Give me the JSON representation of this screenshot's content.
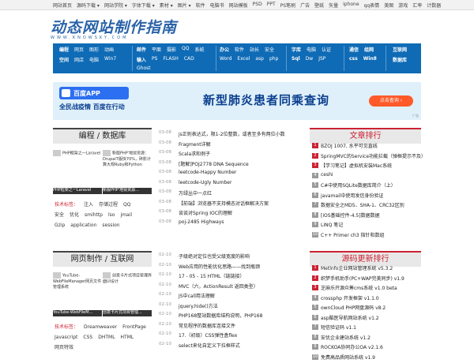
{
  "topbar": {
    "links": [
      "网站首页",
      "源码下载 ▾",
      "网站学院 ▾",
      "字体下载 ▾",
      "素材 ▾",
      "图片 ▾",
      "软件",
      "电脑书",
      "网站模板",
      "PSD",
      "PPT",
      "PS笔刷",
      "广告",
      "壁纸",
      "矢量",
      "iphone",
      "qq表情",
      "美图",
      "游戏",
      "汇率",
      "计数器"
    ]
  },
  "logo": {
    "title": "动态网站制作指南",
    "sub": "WWW.KNOWSKY.COM"
  },
  "nav": {
    "g1": {
      "r1": [
        "编程",
        "网页",
        "图形",
        "动画"
      ],
      "r2": [
        "空间",
        "网店",
        "电脑",
        "Win7"
      ]
    },
    "g2": {
      "r1": [
        "邮件",
        "平面",
        "摄影",
        "QQ",
        "系统"
      ],
      "r2": [
        "输入",
        "PS",
        "FLASH",
        "CAD"
      ],
      "r3": [
        "Ghost"
      ]
    },
    "g3": {
      "r1": [
        "办公",
        "软件",
        "站长",
        "安全"
      ],
      "r2": [
        "Word",
        "Excel",
        "asp",
        "php"
      ]
    },
    "g4": {
      "r1": [
        "字库",
        "电脑",
        "认证"
      ],
      "r2": [
        "Sql",
        "Dw",
        "JSP"
      ]
    },
    "g5": {
      "r1": [
        "通信",
        "组网"
      ],
      "r2": [
        "css",
        "Win8"
      ]
    },
    "g6": {
      "r1": [
        "互联网"
      ],
      "r2": [
        "数据库"
      ]
    }
  },
  "banner": {
    "app": "百度APP",
    "sub": "全民战疫情 百度在行动",
    "headline": "新型肺炎患者同乘查询",
    "button": "点击查询 ›",
    "ad": "广告"
  },
  "sec1": {
    "title": "编程 / 数据库",
    "thumbs": [
      {
        "alt": "PHP框架之一Laravel",
        "cap": "PHP框架之一Laravel"
      },
      {
        "alt": "新版PHP'地狱资源：Drupal7版快70%，碎影计算大规Ruby和Python",
        "cap": "新版PHP'地狱资源..."
      }
    ],
    "tag_label": "技术标签：",
    "tags": [
      "注入",
      "存储过程",
      "QQ",
      "安全",
      "优化",
      "smihttp",
      "lso",
      "jmail",
      "Gzip",
      "application",
      "session"
    ],
    "items": [
      {
        "d": "03-08",
        "t": "js正则表达式，限1-2位整数，或者至多有两位小数"
      },
      {
        "d": "03-08",
        "t": "Fragment详解"
      },
      {
        "d": "03-08",
        "t": "Scala求和例子"
      },
      {
        "d": "03-08",
        "t": "[题解]POJ2778 DNA Sequence"
      },
      {
        "d": "03-08",
        "t": "leetcode-Happy Number"
      },
      {
        "d": "03-08",
        "t": "leetcode-Ugly Number"
      },
      {
        "d": "03-08",
        "t": "万绿丛中一点红"
      },
      {
        "d": "03-08",
        "t": "【前端】浏览器不支持模态对话框解决方案"
      },
      {
        "d": "03-08",
        "t": "谈谈对Spring IOC的理解"
      },
      {
        "d": "03-08",
        "t": "poj-2485 Highways"
      }
    ]
  },
  "sec2": {
    "title": "网页制作 / 互联网",
    "thumbs": [
      {
        "alt": "YouTube-WebFileManager网页文件管理系统",
        "cap": "YouTube-WebFileM..."
      },
      {
        "alt": "创意卡片式项目管理界面UI设计",
        "cap": "创意卡片式项目管理..."
      }
    ],
    "tag_label": "技术标签：",
    "tags": [
      "Dreamweaver",
      "FrontPage",
      "Javascript",
      "CSS",
      "DHTML",
      "HTML",
      "网页特效"
    ],
    "items": [
      {
        "d": "02-10",
        "t": "子级绝对定位也受父级宽度的影响"
      },
      {
        "d": "02-10",
        "t": "Web应用的性能优化思路——找到瓶颈"
      },
      {
        "d": "02-10",
        "t": "17 - 05 - 15 HTML（链链接）"
      },
      {
        "d": "02-10",
        "t": "MVC（六，ActionResult 返回类型）"
      },
      {
        "d": "02-10",
        "t": "JS中call用法理解"
      },
      {
        "d": "02-10",
        "t": "jquery.hide()方法"
      },
      {
        "d": "02-10",
        "t": "PHP168整站数据库结构说明，PHP168"
      },
      {
        "d": "02-10",
        "t": "常见程序的数据库连接文件"
      },
      {
        "d": "02-10",
        "t": "17.（初级）CSS弹性盒flex"
      },
      {
        "d": "02-10",
        "t": "select来化自定义下拉框样式"
      }
    ]
  },
  "rank": {
    "title": "文章排行",
    "items": [
      "BZOJ 1007, 水平可见直线",
      "SpringMVC的Service功能拦截（弹框提示不及）",
      "【学习笔记】虚拟机安装Mac系统",
      "ceshi",
      "C#中使用SQLite数据库简介（上）",
      "javamail中使用发信身份验证",
      "数据安全之MD5、SHA-1、CRC32区别",
      "[iOS基础控件-4.5]数据数据",
      "LINQ 笔记",
      "C++ Primer ch3 指针和数组"
    ]
  },
  "src": {
    "title": "源码更新排行",
    "items": [
      "Metlnfo企业网站管理系统 v5.3.2",
      "织梦手机助手(PC+WAP完美同步) v1.9",
      "芝麻乐开源众筹cms系统 v1.0 beta",
      "crossphp 开发框架 v1.1.0",
      "ownCloud PHP网盘源码 v8.2",
      "asp酷医导航网站系统 v1.2",
      "短信验证码 v1.1",
      "安优企业建站系统 v1.2",
      "ROCKOA协同办公OA v2.1.6",
      "免费高品质网站系统 v1.9"
    ]
  }
}
